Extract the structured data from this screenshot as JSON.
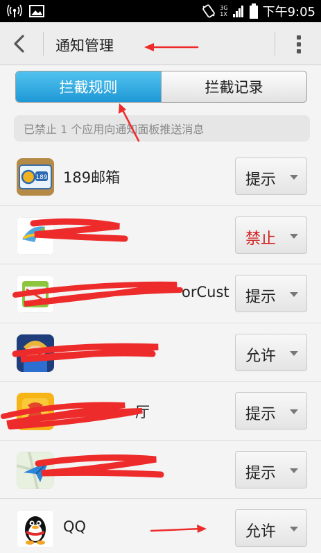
{
  "statusbar": {
    "icons": [
      "wifi-hotspot-icon",
      "image-icon",
      "vibrate-icon",
      "signal-icon",
      "battery-icon"
    ],
    "network_top": "3G",
    "network_bottom": "1X",
    "time": "下午9:05"
  },
  "actionbar": {
    "title": "通知管理",
    "back_icon": "chevron-left-icon",
    "menu_icon": "overflow-menu-icon"
  },
  "tabs": [
    {
      "label": "拦截规则",
      "active": true
    },
    {
      "label": "拦截记录",
      "active": false
    }
  ],
  "notice": "已禁止 1 个应用向通知面板推送消息",
  "apps": [
    {
      "name": "189邮箱",
      "status": "提示",
      "status_color": "#222222",
      "icon": "mail-189-icon"
    },
    {
      "name": "",
      "status": "禁止",
      "status_color": "#d12020",
      "icon": "app-bird-icon"
    },
    {
      "name": "orCust",
      "status": "提示",
      "status_color": "#222222",
      "icon": "android-app-icon"
    },
    {
      "name": "",
      "status": "允许",
      "status_color": "#222222",
      "icon": "game-character-icon"
    },
    {
      "name": "厅",
      "status": "提示",
      "status_color": "#222222",
      "icon": "orange-app-icon"
    },
    {
      "name": "",
      "status": "提示",
      "status_color": "#222222",
      "icon": "map-plane-icon"
    },
    {
      "name": "QQ",
      "status": "允许",
      "status_color": "#222222",
      "icon": "qq-penguin-icon"
    }
  ],
  "colors": {
    "accent": "#1f98d6",
    "annotation": "#ee2b2b",
    "block_red": "#d12020"
  }
}
